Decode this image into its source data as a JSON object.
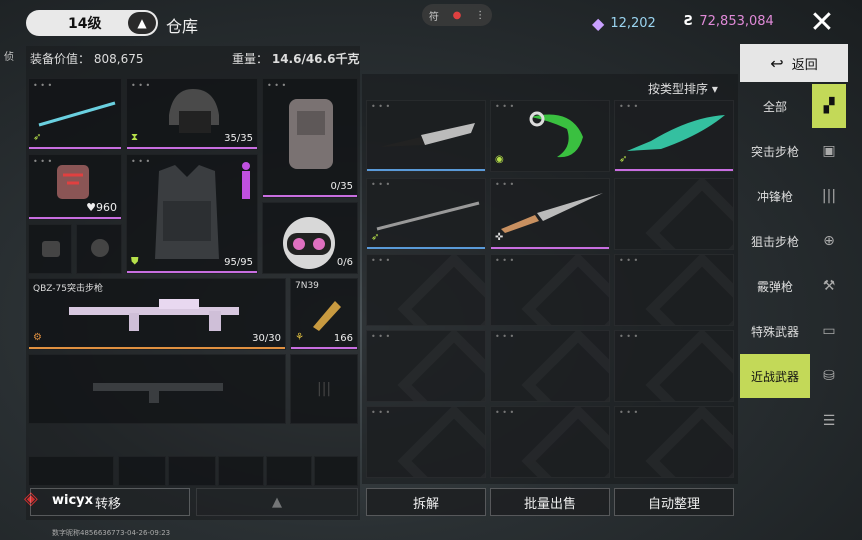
{
  "header": {
    "level": "14级",
    "title": "仓库",
    "center_text": "符",
    "gems": "12,202",
    "coins": "72,853,084"
  },
  "left": {
    "side_tab": "侦",
    "equip_value_label": "装备价值：",
    "equip_value": "808,675",
    "weight_label": "重量：",
    "weight": "14.6/46.6千克",
    "helmet_count": "35/35",
    "backpack_count": "0/35",
    "armor_count": "95/95",
    "pet_count": "0/6",
    "pouch_count": "960",
    "gun_name": "QBZ-75突击步枪",
    "gun_count": "30/30",
    "ammo_name": "7N39",
    "ammo_count": "166"
  },
  "sort_label": "按类型排序",
  "sidebar": {
    "back": "返回",
    "items": [
      "全部",
      "突击步枪",
      "冲锋枪",
      "狙击步枪",
      "霰弹枪",
      "特殊武器",
      "近战武器"
    ],
    "active_index": 6
  },
  "bottom": {
    "user": "wicyx",
    "transfer": "转移",
    "dismantle": "拆解",
    "bulk_sell": "批量出售",
    "auto_sort": "自动整理"
  },
  "footer": "数字昵称4856636773-04-26-09:23",
  "colors": {
    "accent": "#c3d958",
    "epic": "#c86ee0",
    "rare": "#5a9ad8",
    "legend": "#e09040"
  }
}
